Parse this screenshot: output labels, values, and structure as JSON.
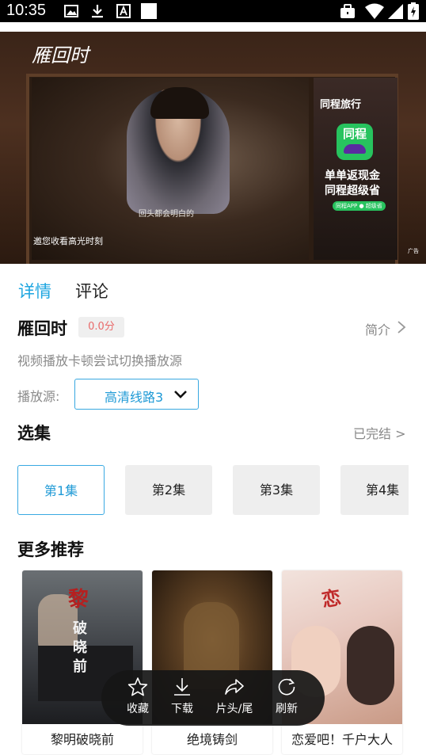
{
  "status": {
    "time": "10:35"
  },
  "video": {
    "show_logo": "雁回时",
    "subtitle": "回头都会明白的",
    "overlay": "邀您收看高光时刻",
    "ad": {
      "brand": "同程旅行",
      "logo_text": "同程",
      "line1": "单单返现金",
      "line2": "同程超级省",
      "badge": "同程APP ● 超级省",
      "tag": "广告"
    }
  },
  "tabs": [
    "详情",
    "评论"
  ],
  "detail": {
    "title": "雁回时",
    "score": "0.0分",
    "intro": "简介",
    "hint": "视频播放卡顿尝试切换播放源",
    "source_label": "播放源:",
    "source_value": "高清线路3"
  },
  "episodes": {
    "title": "选集",
    "status": "已完结 >",
    "items": [
      "第1集",
      "第2集",
      "第3集",
      "第4集"
    ]
  },
  "recommend": {
    "title": "更多推荐",
    "items": [
      {
        "name": "黎明破晓前"
      },
      {
        "name": "绝境铸剑"
      },
      {
        "name": "恋爱吧！千户大人"
      }
    ]
  },
  "toolbar": {
    "items": [
      {
        "label": "收藏",
        "icon": "star-icon"
      },
      {
        "label": "下载",
        "icon": "download-icon"
      },
      {
        "label": "片头/尾",
        "icon": "share-arrow-icon"
      },
      {
        "label": "刷新",
        "icon": "refresh-icon"
      }
    ]
  },
  "colors": {
    "accent": "#1fa6e0",
    "score": "#e96a6a",
    "toolbar_bg": "#161616"
  }
}
